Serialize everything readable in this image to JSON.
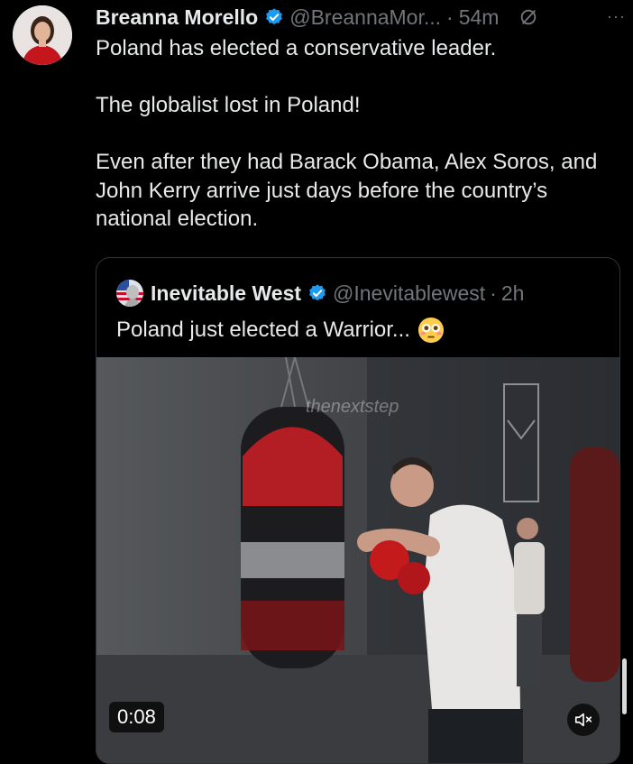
{
  "tweet": {
    "author_name": "Breanna Morello",
    "author_handle": "@BreannaMor...",
    "separator": "·",
    "time": "54m",
    "more": "···",
    "paragraphs": [
      "Poland has elected a conservative leader.",
      "The globalist lost in Poland!",
      "Even after they had Barack Obama, Alex Soros, and John Kerry arrive just days before the country’s national election."
    ]
  },
  "quoted": {
    "author_name": "Inevitable West",
    "author_handle": "@Inevitablewest",
    "separator": "·",
    "time": "2h",
    "text": "Poland just elected a Warrior...",
    "emoji_icon": "flushed-face-icon"
  },
  "video": {
    "duration": "0:08",
    "watermark": "thenextstep",
    "mute_icon": "speaker-muted-icon"
  },
  "colors": {
    "background": "#000000",
    "text": "#e7e9ea",
    "muted": "#71767b",
    "verified": "#1d9bf0",
    "border": "#2f3336"
  }
}
